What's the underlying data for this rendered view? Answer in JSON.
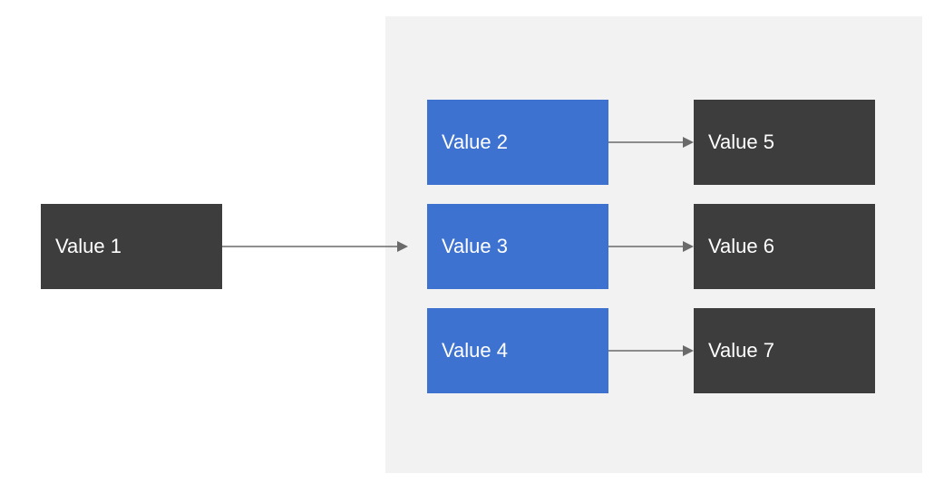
{
  "nodes": {
    "value1": "Value 1",
    "value2": "Value 2",
    "value3": "Value 3",
    "value4": "Value 4",
    "value5": "Value 5",
    "value6": "Value 6",
    "value7": "Value 7"
  },
  "colors": {
    "dark_box": "#3d3d3d",
    "blue_box": "#3d72d1",
    "panel_bg": "#f2f2f2",
    "arrow": "#6a6a6a",
    "text": "#ffffff"
  }
}
